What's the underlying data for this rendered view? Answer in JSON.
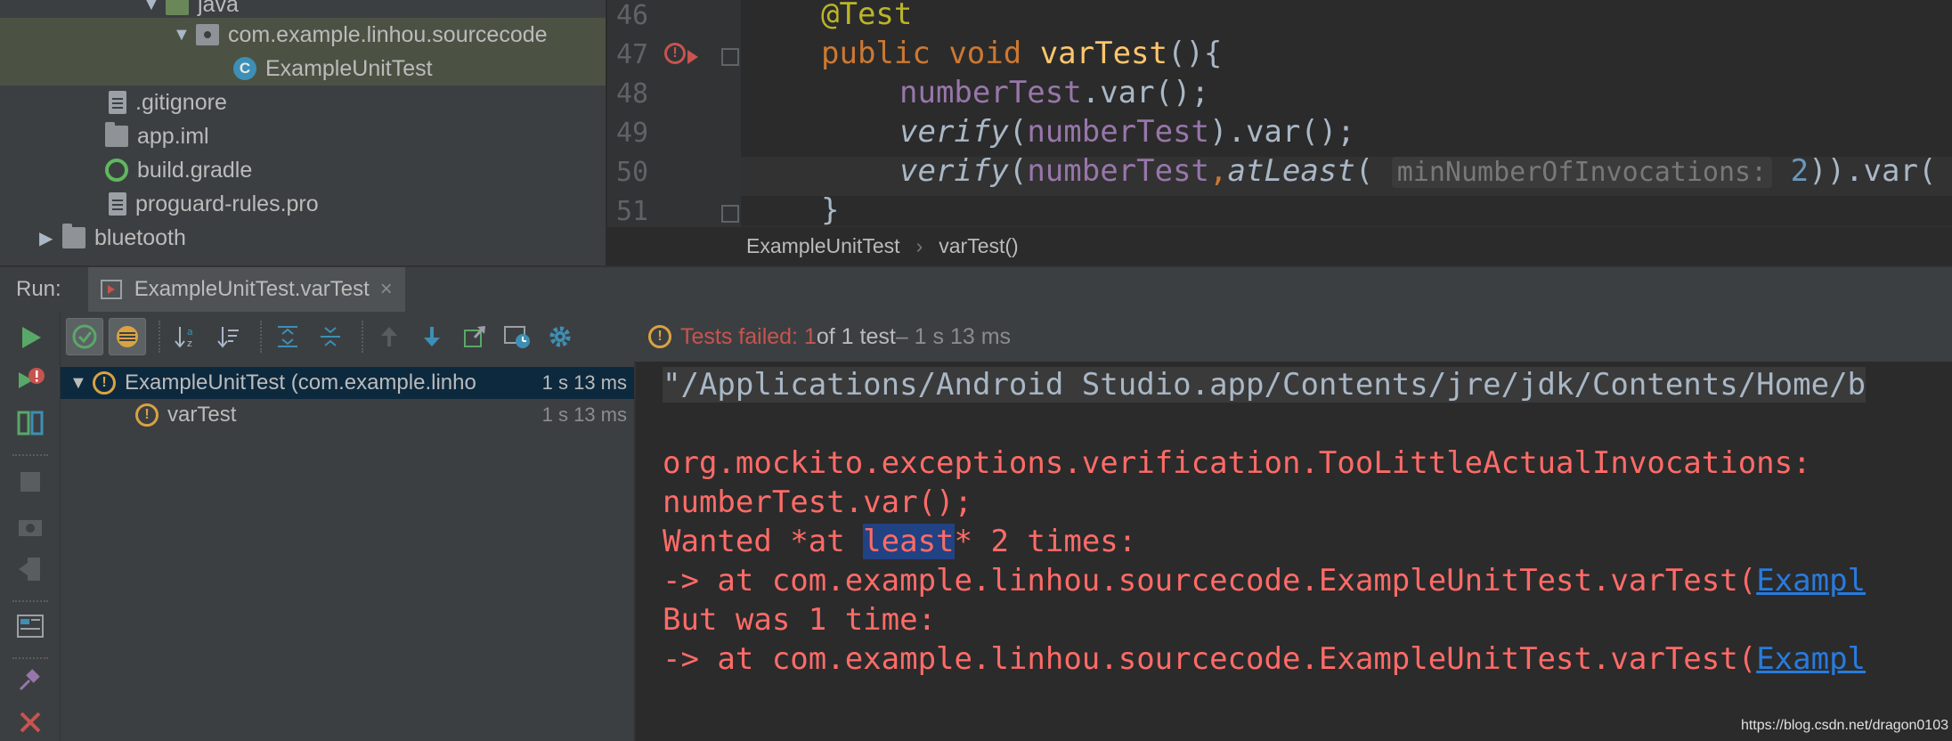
{
  "project_tree": {
    "rows": [
      {
        "label": "java",
        "arrow": "▼"
      },
      {
        "label": "com.example.linhou.sourcecode",
        "arrow": "▼"
      },
      {
        "label": "ExampleUnitTest",
        "class_letter": "C"
      },
      {
        "label": ".gitignore"
      },
      {
        "label": "app.iml"
      },
      {
        "label": "build.gradle"
      },
      {
        "label": "proguard-rules.pro"
      },
      {
        "label": "bluetooth",
        "arrow": "▶"
      }
    ]
  },
  "editor": {
    "line_numbers": [
      "46",
      "47",
      "48",
      "49",
      "50",
      "51"
    ],
    "error_mark": "!",
    "code": {
      "l46_annotation": "@Test",
      "l47_public": "public",
      "l47_void": "void",
      "l47_name": "varTest",
      "l47_rest": "(){",
      "l48_field": "numberTest",
      "l48_rest": ".var();",
      "l49_verify": "verify",
      "l49_open": "(",
      "l49_field": "numberTest",
      "l49_rest": ").var();",
      "l50_verify": "verify",
      "l50_open": "(",
      "l50_field": "numberTest",
      "l50_comma": ",",
      "l50_atleast": "atLeast",
      "l50_open2": "( ",
      "l50_hint": "minNumberOfInvocations:",
      "l50_num": "2",
      "l50_rest": ")).var(",
      "l51_brace": "}"
    },
    "breadcrumb": [
      "ExampleUnitTest",
      "varTest()"
    ],
    "breadcrumb_sep": "›"
  },
  "run_window": {
    "label": "Run:",
    "tab_label": "ExampleUnitTest.varTest",
    "tab_close": "×",
    "status": {
      "failed_label": "Tests failed: 1",
      "of_total": " of 1 test",
      "duration": " – 1 s 13 ms"
    },
    "tests": [
      {
        "label": "ExampleUnitTest (com.example.linho",
        "time": "1 s 13 ms",
        "arrow": "▼"
      },
      {
        "label": "varTest",
        "time": "1 s 13 ms"
      }
    ],
    "warn_mark": "!",
    "console": {
      "cmd": "\"/Applications/Android Studio.app/Contents/jre/jdk/Contents/Home/b",
      "exc": "org.mockito.exceptions.verification.TooLittleActualInvocations:",
      "call": "numberTest.var();",
      "wanted_pre": "Wanted *at ",
      "wanted_hl": "least",
      "wanted_post": "* 2 times:",
      "at1_pre": "-> at com.example.linhou.sourcecode.ExampleUnitTest.varTest(",
      "at1_link": "Exampl",
      "but": "But was 1 time:",
      "at2_pre": "-> at com.example.linhou.sourcecode.ExampleUnitTest.varTest(",
      "at2_link": "Exampl"
    }
  },
  "watermark": "https://blog.csdn.net/dragon0103",
  "colors": {
    "background": "#2b2b2b",
    "panel": "#3c3f41",
    "error": "#ff6b68",
    "keyword": "#cc7832",
    "field": "#9876aa",
    "link": "#287bde"
  }
}
